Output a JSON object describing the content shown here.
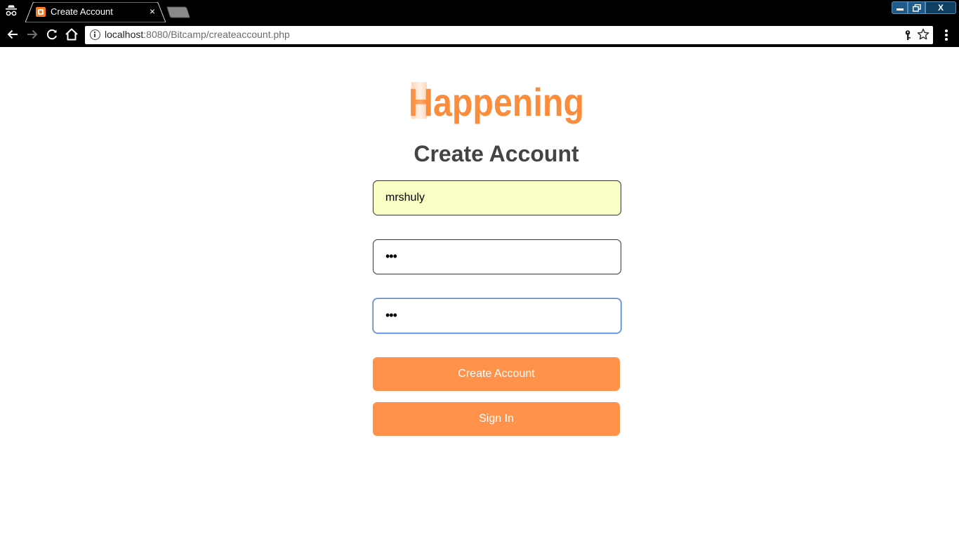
{
  "browser": {
    "tab_title": "Create Account",
    "url_host": "localhost",
    "url_rest": ":8080/Bitcamp/createaccount.php",
    "tab_close": "×",
    "window_close": "X"
  },
  "page": {
    "logo_text": "Happening",
    "heading": "Create Account",
    "username_value": "mrshuly",
    "password_dots": "•••",
    "confirm_dots": "•••",
    "create_button_label": "Create Account",
    "signin_button_label": "Sign In"
  },
  "colors": {
    "accent": "#fe924a",
    "logo": "#fb8c3c",
    "heading": "#444444",
    "autofill_bg": "#fafec4",
    "focus_border": "#4d7fd8",
    "chrome_bg": "#000000"
  }
}
